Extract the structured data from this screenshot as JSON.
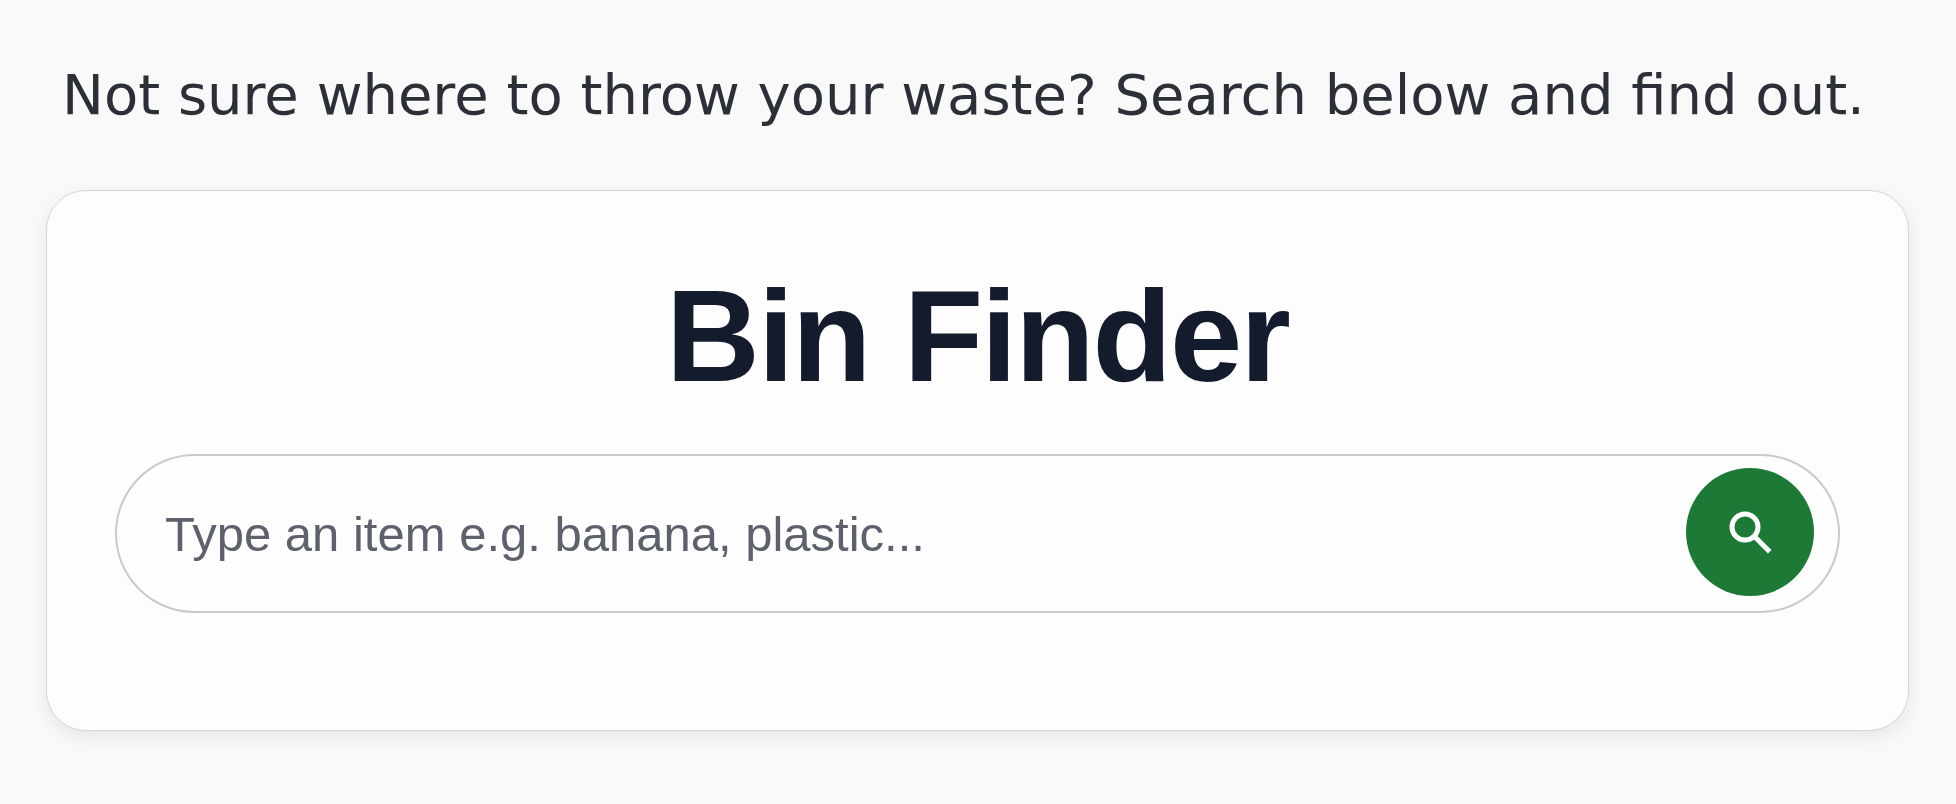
{
  "intro": "Not sure where to throw your waste? Search below and find out.",
  "card": {
    "title": "Bin Finder",
    "search": {
      "placeholder": "Type an item e.g. banana, plastic..."
    }
  }
}
